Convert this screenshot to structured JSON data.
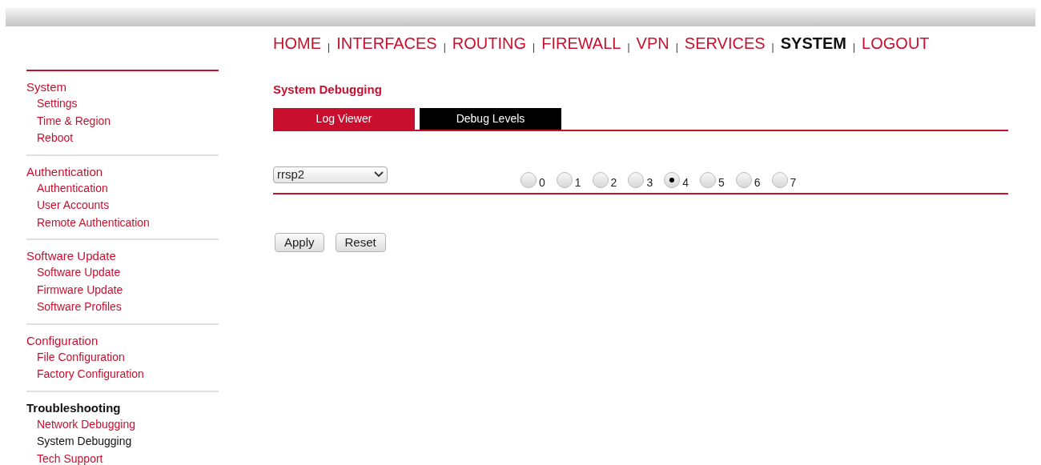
{
  "nav": [
    {
      "label": "HOME",
      "selected": false
    },
    {
      "label": "INTERFACES",
      "selected": false
    },
    {
      "label": "ROUTING",
      "selected": false
    },
    {
      "label": "FIREWALL",
      "selected": false
    },
    {
      "label": "VPN",
      "selected": false
    },
    {
      "label": "SERVICES",
      "selected": false
    },
    {
      "label": "SYSTEM",
      "selected": true
    },
    {
      "label": "LOGOUT",
      "selected": false
    }
  ],
  "nav_separator": "|",
  "sidebar": [
    {
      "title": "System",
      "selected": false,
      "children": [
        {
          "label": "Settings",
          "selected": false
        },
        {
          "label": "Time & Region",
          "selected": false
        },
        {
          "label": "Reboot",
          "selected": false
        }
      ]
    },
    {
      "title": "Authentication",
      "selected": false,
      "children": [
        {
          "label": "Authentication",
          "selected": false
        },
        {
          "label": "User Accounts",
          "selected": false
        },
        {
          "label": "Remote Authentication",
          "selected": false
        }
      ]
    },
    {
      "title": "Software Update",
      "selected": false,
      "children": [
        {
          "label": "Software Update",
          "selected": false
        },
        {
          "label": "Firmware Update",
          "selected": false
        },
        {
          "label": "Software Profiles",
          "selected": false
        }
      ]
    },
    {
      "title": "Configuration",
      "selected": false,
      "children": [
        {
          "label": "File Configuration",
          "selected": false
        },
        {
          "label": "Factory Configuration",
          "selected": false
        }
      ]
    },
    {
      "title": "Troubleshooting",
      "selected": true,
      "children": [
        {
          "label": "Network Debugging",
          "selected": false
        },
        {
          "label": "System Debugging",
          "selected": true
        },
        {
          "label": "Tech Support",
          "selected": false
        }
      ]
    }
  ],
  "page_title": "System Debugging",
  "tabs": [
    {
      "label": "Log Viewer",
      "selected": false
    },
    {
      "label": "Debug Levels",
      "selected": true
    }
  ],
  "module_select": {
    "value": "rrsp2"
  },
  "levels": [
    {
      "label": "0",
      "selected": false
    },
    {
      "label": "1",
      "selected": false
    },
    {
      "label": "2",
      "selected": false
    },
    {
      "label": "3",
      "selected": false
    },
    {
      "label": "4",
      "selected": true
    },
    {
      "label": "5",
      "selected": false
    },
    {
      "label": "6",
      "selected": false
    },
    {
      "label": "7",
      "selected": false
    }
  ],
  "buttons": [
    "Apply",
    "Reset"
  ]
}
